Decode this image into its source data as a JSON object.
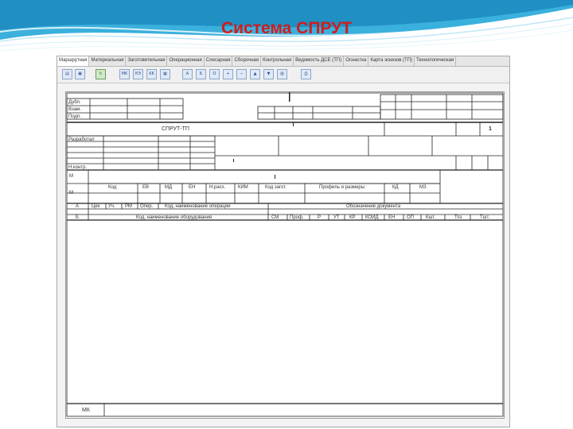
{
  "slide": {
    "title": "Система СПРУТ",
    "colors": {
      "title": "#d01c1c",
      "wave_dark": "#2a9fd0",
      "wave_light": "#a9dcf2"
    }
  },
  "app": {
    "tabs": [
      {
        "label": "Маршрутная"
      },
      {
        "label": "Материальная"
      },
      {
        "label": "Заготовительная"
      },
      {
        "label": "Операционная"
      },
      {
        "label": "Слесарная"
      },
      {
        "label": "Сборочная"
      },
      {
        "label": "Контрольная"
      },
      {
        "label": "Ведомость ДСЕ (ТП)"
      },
      {
        "label": "Оснастка"
      },
      {
        "label": "Карта эскизов (ТП)"
      },
      {
        "label": "Технологическая"
      }
    ],
    "toolbar": [
      {
        "icon": "open-icon",
        "text": "▤"
      },
      {
        "icon": "save-icon",
        "text": "▣"
      },
      {
        "icon": "refresh-icon",
        "text": "↻"
      },
      {
        "icon": "mk-icon",
        "text": "MK"
      },
      {
        "icon": "kz-icon",
        "text": "КЭ"
      },
      {
        "icon": "kk-icon",
        "text": "KK"
      },
      {
        "icon": "sheet-icon",
        "text": "▦"
      },
      {
        "icon": "op-icon",
        "text": "А"
      },
      {
        "icon": "page-icon",
        "text": "Б"
      },
      {
        "icon": "row-icon",
        "text": "О"
      },
      {
        "icon": "insert-row-icon",
        "text": "+"
      },
      {
        "icon": "delete-row-icon",
        "text": "−"
      },
      {
        "icon": "up-icon",
        "text": "▲"
      },
      {
        "icon": "down-icon",
        "text": "▼"
      },
      {
        "icon": "grid-icon",
        "text": "▥"
      },
      {
        "icon": "print-icon",
        "text": "⎙"
      }
    ]
  },
  "form": {
    "left_labels": [
      "Дубл.",
      "Взам.",
      "Подп."
    ],
    "system_name": "СПРУТ-ТП",
    "sheet_number": "1",
    "developed_label": "Разработал",
    "norm_control_label": "Н.контр.",
    "row_a_label": "М",
    "row_b_label": "М",
    "header_cols": [
      "Код",
      "ЕВ",
      "МД",
      "ЕН",
      "Н.расх.",
      "КИМ",
      "Код загот.",
      "Профиль и размеры",
      "КД",
      "МЗ"
    ],
    "row_a_prefix": "А",
    "row_b_prefix": "Б",
    "header_row2": [
      "Цех",
      "Уч.",
      "РМ",
      "Опер.",
      "Код, наименование операции",
      "Обозначение документа"
    ],
    "header_row3": [
      "Код, наименование оборудования",
      "СМ",
      "Проф.",
      "Р",
      "УТ",
      "КР",
      "КОИД",
      "ЕН",
      "ОП",
      "Кшт.",
      "Тпз",
      "Тшт."
    ],
    "footer_label": "МК"
  }
}
